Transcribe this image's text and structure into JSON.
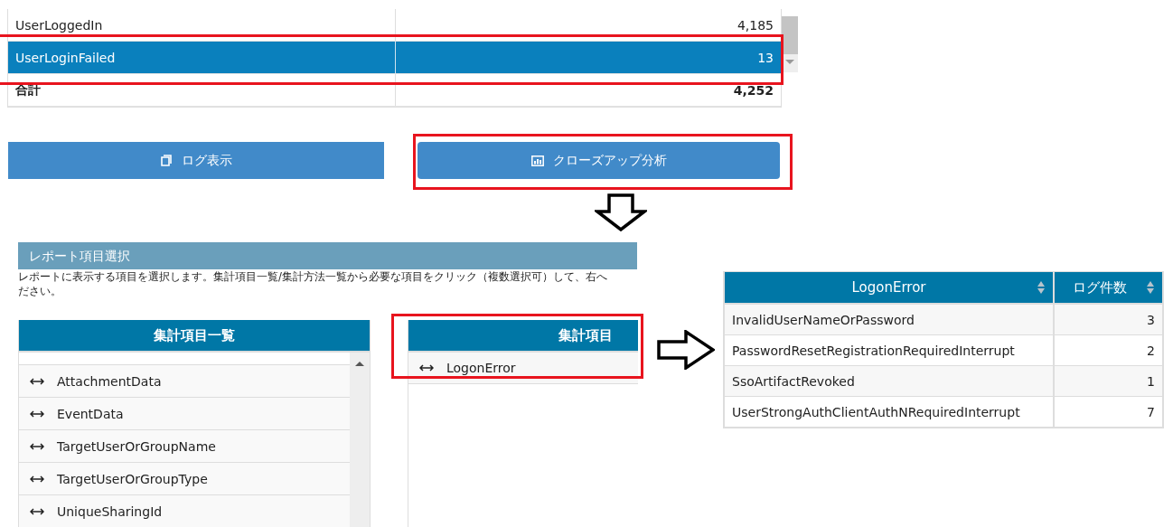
{
  "event_table": {
    "rows": [
      {
        "name": "UserLoggedIn",
        "count": "4,185",
        "selected": false
      },
      {
        "name": "UserLoginFailed",
        "count": "13",
        "selected": true
      }
    ],
    "total": {
      "label": "合計",
      "count": "4,252"
    }
  },
  "buttons": [
    {
      "label": "ログ表示",
      "kind": "log"
    },
    {
      "label": "クローズアップ分析",
      "kind": "chart"
    }
  ],
  "report_panel": {
    "title": "レポート項目選択",
    "description_lines": [
      "レポートに表示する項目を選択します。集計項目一覧/集計方法一覧から必要な項目をクリック（複数選択可）して、右へ",
      "ださい。"
    ]
  },
  "field_list": {
    "title": "集計項目一覧",
    "items": [
      "AttachmentData",
      "EventData",
      "TargetUserOrGroupName",
      "TargetUserOrGroupType",
      "UniqueSharingId"
    ]
  },
  "selected_fields": {
    "title": "集計項目",
    "items": [
      "LogonError"
    ]
  },
  "result_table": {
    "columns": [
      "LogonError",
      "ログ件数"
    ],
    "rows": [
      [
        "InvalidUserNameOrPassword",
        "3"
      ],
      [
        "PasswordResetRegistrationRequiredInterrupt",
        "2"
      ],
      [
        "SsoArtifactRevoked",
        "1"
      ],
      [
        "UserStrongAuthClientAuthNRequiredInterrupt",
        "7"
      ]
    ]
  }
}
